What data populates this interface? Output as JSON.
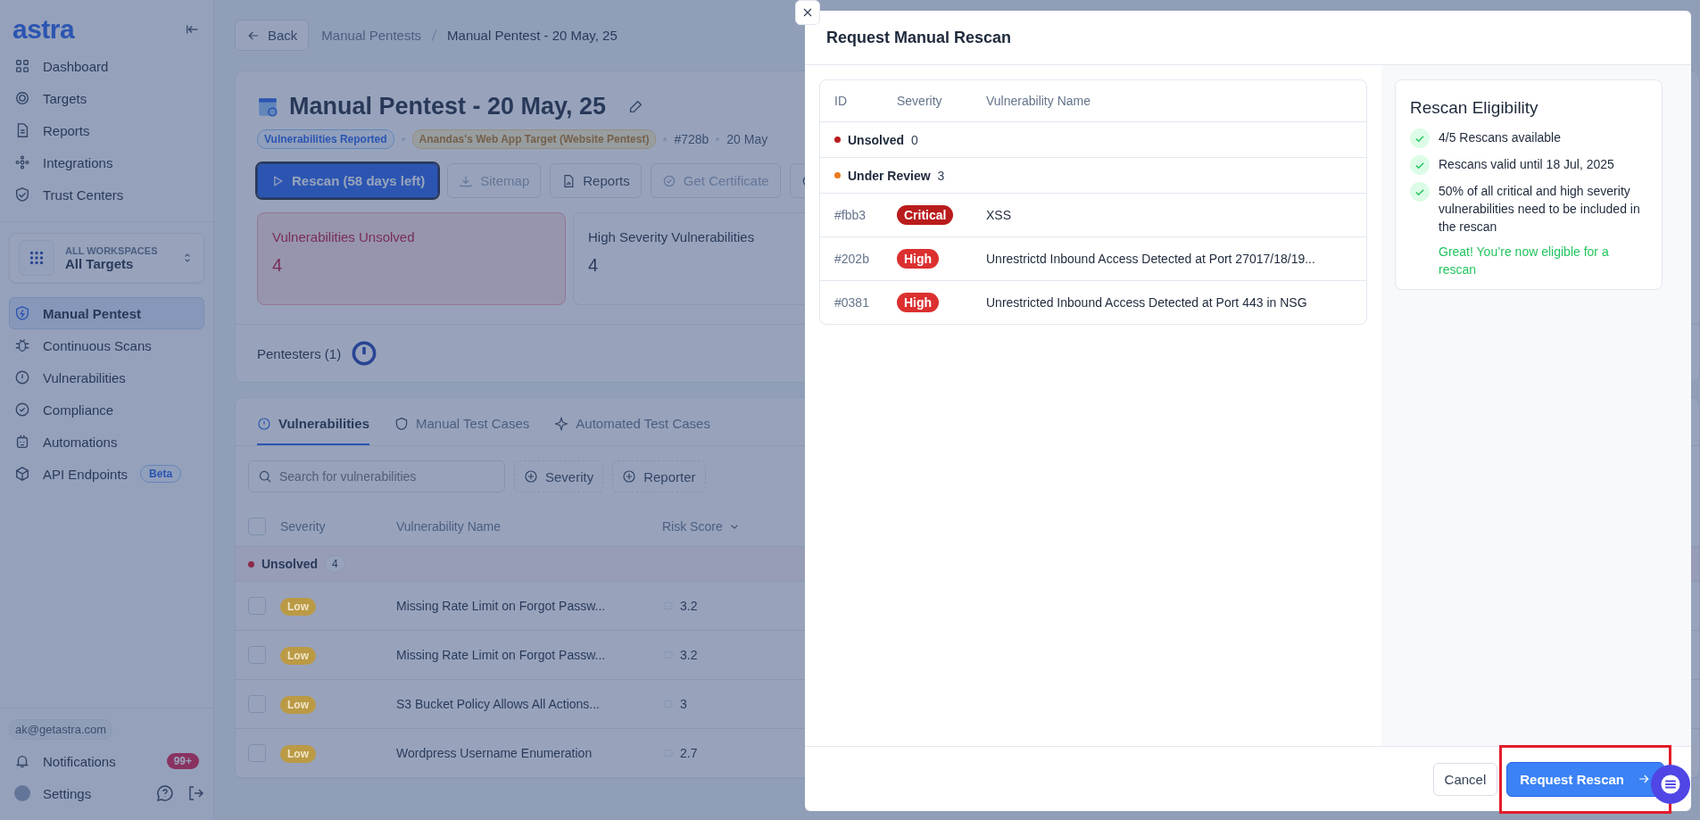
{
  "sidebar": {
    "logo": "astra",
    "nav": [
      {
        "label": "Dashboard"
      },
      {
        "label": "Targets"
      },
      {
        "label": "Reports"
      },
      {
        "label": "Integrations"
      },
      {
        "label": "Trust Centers"
      }
    ],
    "workspace": {
      "caption": "ALL WORKSPACES",
      "value": "All Targets"
    },
    "nav2": [
      {
        "label": "Manual Pentest",
        "selected": true
      },
      {
        "label": "Continuous Scans",
        "selected": false
      },
      {
        "label": "Vulnerabilities",
        "selected": false
      },
      {
        "label": "Compliance",
        "selected": false
      },
      {
        "label": "Automations",
        "selected": false
      },
      {
        "label": "API Endpoints",
        "selected": false,
        "badge": "Beta"
      }
    ],
    "user_email": "ak@getastra.com",
    "notifications": {
      "label": "Notifications",
      "count": "99+"
    },
    "settings": "Settings"
  },
  "breadcrumb": {
    "back": "Back",
    "items": [
      {
        "label": "Manual Pentests",
        "current": false
      },
      {
        "label": "Manual Pentest - 20 May, 25",
        "current": true
      }
    ]
  },
  "pentest": {
    "title": "Manual Pentest - 20 May, 25",
    "status": "Vulnerabilities Reported",
    "target": "Anandas's Web App Target (Website Pentest)",
    "id": "#728b",
    "date": "20 May",
    "actions": [
      {
        "label": "Rescan (58 days left)",
        "kind": "primary",
        "disabled": false
      },
      {
        "label": "Sitemap",
        "kind": "secondary",
        "disabled": true
      },
      {
        "label": "Reports",
        "kind": "secondary",
        "disabled": false
      },
      {
        "label": "Get Certificate",
        "kind": "secondary",
        "disabled": true
      },
      {
        "kind": "icon",
        "disabled": false
      }
    ],
    "stats": [
      {
        "label": "Vulnerabilities Unsolved",
        "value": "4",
        "kind": "alert"
      },
      {
        "label": "High Severity Vulnerabilities",
        "value": "4",
        "kind": "normal"
      }
    ],
    "pentesters": "Pentesters (1)"
  },
  "tabs": [
    {
      "label": "Vulnerabilities",
      "selected": true
    },
    {
      "label": "Manual Test Cases",
      "selected": false
    },
    {
      "label": "Automated Test Cases",
      "selected": false
    }
  ],
  "search": {
    "placeholder": "Search for vulnerabilities"
  },
  "filters": [
    "Severity",
    "Reporter"
  ],
  "table": {
    "select_all_checked": false,
    "columns": [
      "Severity",
      "Vulnerability Name",
      "Risk Score"
    ],
    "group": {
      "label": "Unsolved",
      "count": "4",
      "color": "#8c2a4a"
    },
    "rows": [
      {
        "checked": false,
        "severity": "Low",
        "color": "#bb9a45",
        "name": "Missing Rate Limit on Forgot Passw...",
        "score": "3.2"
      },
      {
        "checked": false,
        "severity": "Low",
        "color": "#bb9a45",
        "name": "Missing Rate Limit on Forgot Passw...",
        "score": "3.2"
      },
      {
        "checked": false,
        "severity": "Low",
        "color": "#bb9a45",
        "name": "S3 Bucket Policy Allows All Actions...",
        "score": "3"
      },
      {
        "checked": false,
        "severity": "Low",
        "color": "#bb9a45",
        "name": "Wordpress Username Enumeration",
        "score": "2.7"
      }
    ]
  },
  "modal": {
    "title": "Request Manual Rescan",
    "columns": [
      "ID",
      "Severity",
      "Vulnerability Name"
    ],
    "groups": [
      {
        "label": "Unsolved",
        "count": "0",
        "color": "#b91c1c"
      },
      {
        "label": "Under Review",
        "count": "3",
        "color": "#ea7a1c"
      }
    ],
    "rows": [
      {
        "id": "#fbb3",
        "severity": "Critical",
        "color": "#b91c1c",
        "name": "XSS"
      },
      {
        "id": "#202b",
        "severity": "High",
        "color": "#dc3030",
        "name": "Unrestrictd Inbound Access Detected at Port 27017/18/19..."
      },
      {
        "id": "#0381",
        "severity": "High",
        "color": "#dc3030",
        "name": "Unrestricted Inbound Access Detected at Port 443 in NSG"
      }
    ],
    "eligibility": {
      "title": "Rescan Eligibility",
      "items": [
        "4/5 Rescans available",
        "Rescans valid until 18 Jul, 2025",
        "50% of all critical and high severity vulnerabilities need to be included in the rescan"
      ],
      "message": "Great! You’re now eligible for a rescan"
    },
    "cancel": "Cancel",
    "submit": "Request Rescan",
    "highlight_submit": true
  }
}
